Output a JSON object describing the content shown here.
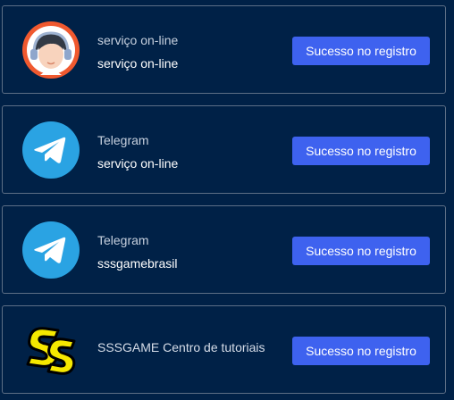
{
  "contacts": [
    {
      "icon": "headset-support-avatar-icon",
      "line1": "serviço on-line",
      "line2": "serviço on-line",
      "button": "Sucesso no registro"
    },
    {
      "icon": "telegram-icon",
      "line1": "Telegram",
      "line2": "serviço on-line",
      "button": "Sucesso no registro"
    },
    {
      "icon": "telegram-icon",
      "line1": "Telegram",
      "line2": "sssgamebrasil",
      "button": "Sucesso no registro"
    },
    {
      "icon": "sss-logo-icon",
      "line1": "SSSGAME Centro de tutoriais",
      "line2": "",
      "button": "Sucesso no registro"
    }
  ],
  "colors": {
    "background": "#002147",
    "button": "#3e62ef",
    "telegram": "#2aa3e3",
    "support_ring": "#f0592f",
    "logo_yellow": "#f5e800"
  }
}
